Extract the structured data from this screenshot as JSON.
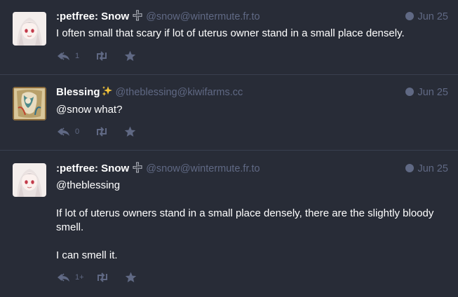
{
  "statuses": [
    {
      "display_name": ":petfree: Snow",
      "acct": "@snow@wintermute.fr.to",
      "time": "Jun 25",
      "paragraphs": [
        "I often small that scary if lot of uterus owner stand in a small place densely."
      ],
      "reply_count": "1",
      "avatar": "anime-girl-white-hair"
    },
    {
      "display_name": "Blessing",
      "acct": "@theblessing@kiwifarms.cc",
      "time": "Jun 25",
      "paragraphs": [
        "@snow what?"
      ],
      "reply_count": "0",
      "avatar": "ornate-illustration"
    },
    {
      "display_name": ":petfree: Snow",
      "acct": "@snow@wintermute.fr.to",
      "time": "Jun 25",
      "paragraphs": [
        "@theblessing",
        "If lot of uterus owners stand in a small place densely, there are the slightly bloody smell.",
        "I can smell it."
      ],
      "reply_count": "1+",
      "avatar": "anime-girl-white-hair"
    }
  ],
  "colors": {
    "background": "#282c37",
    "divider": "#393f4f",
    "muted": "#606984",
    "text": "#ffffff"
  }
}
